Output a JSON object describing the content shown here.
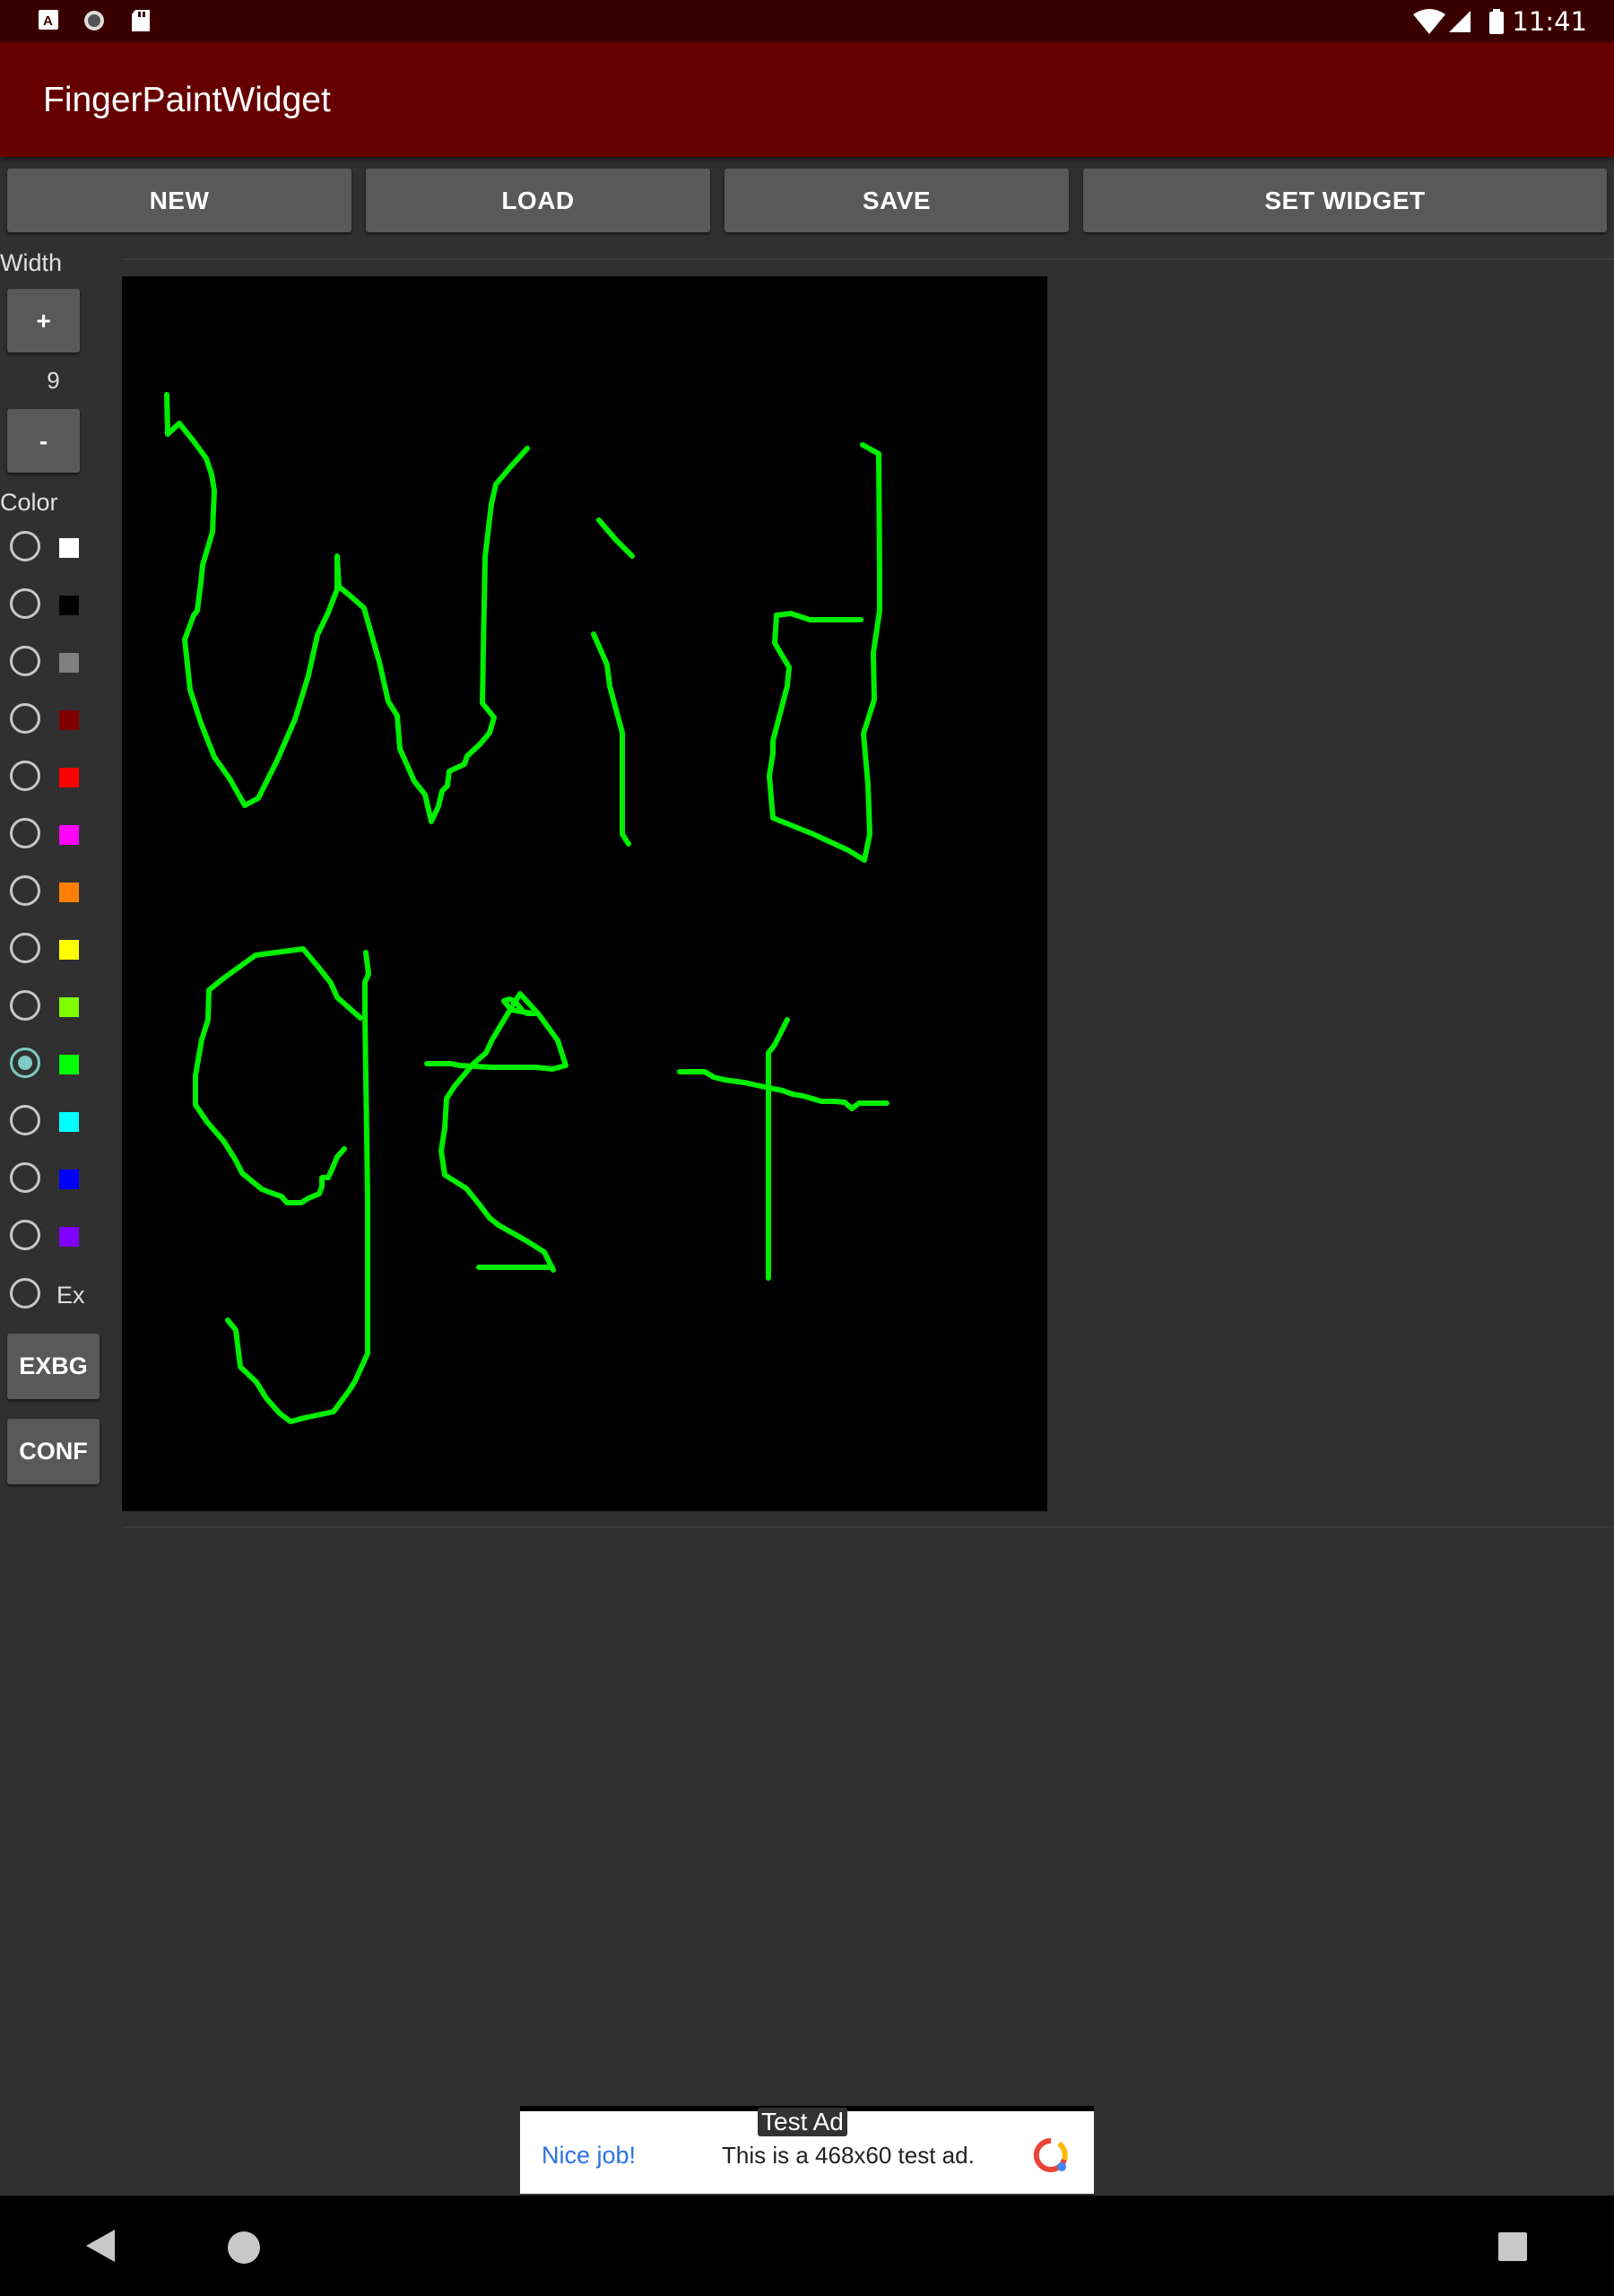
{
  "status_bar": {
    "time": "11:41"
  },
  "app_bar": {
    "title": "FingerPaintWidget"
  },
  "toolbar": {
    "new_label": "NEW",
    "load_label": "LOAD",
    "save_label": "SAVE",
    "set_widget_label": "SET WIDGET"
  },
  "width_panel": {
    "label": "Width",
    "plus_label": "+",
    "value": "9",
    "minus_label": "-"
  },
  "color_panel": {
    "label": "Color",
    "colors": [
      "#ffffff",
      "#000000",
      "#808080",
      "#800000",
      "#ff0000",
      "#ff00ff",
      "#ff8000",
      "#ffff00",
      "#80ff00",
      "#00ff00",
      "#00ffff",
      "#0000ff",
      "#8000ff"
    ],
    "selected_index": 9,
    "ex_label": "Ex",
    "exbg_label": "EXBG",
    "conf_label": "CONF"
  },
  "canvas": {
    "stroke_color": "#00ee00"
  },
  "ad": {
    "tag": "Test Ad",
    "left_text": "Nice job!",
    "text": "This is a 468x60 test ad."
  }
}
